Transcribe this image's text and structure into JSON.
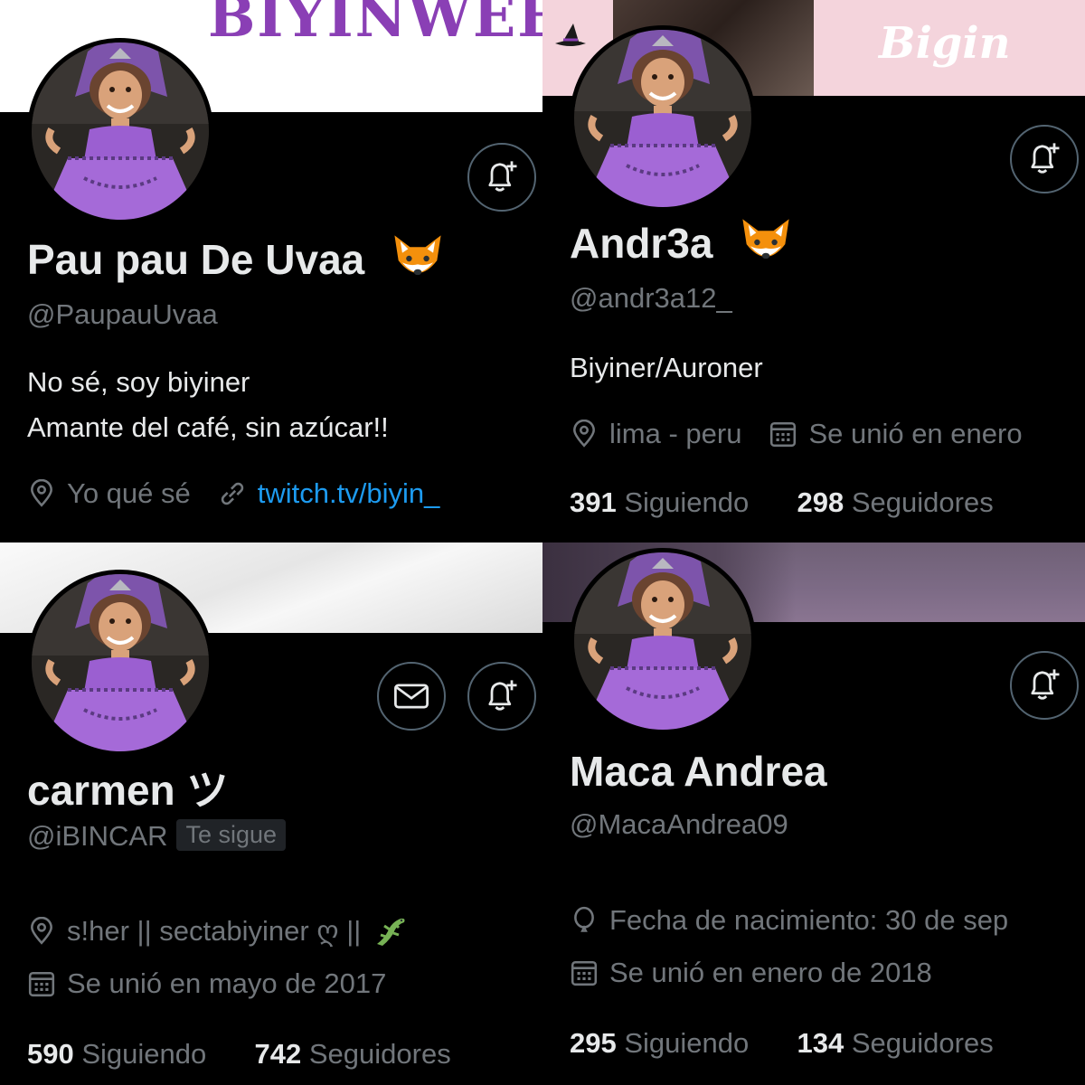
{
  "profiles": [
    {
      "banner_text": "BIYINWEEN",
      "name": "Pau pau De Uvaa",
      "name_emoji": "fox-face-icon",
      "handle": "@PaupauUvaa",
      "bio_lines": [
        "No sé, soy biyiner",
        "Amante del café, sin azúcar!!"
      ],
      "location": "Yo qué sé",
      "link": "twitch.tv/biyin_"
    },
    {
      "banner_text": "Bigin",
      "name": "Andr3a",
      "name_emoji": "fox-face-icon",
      "handle": "@andr3a12_",
      "bio_lines": [
        "Biyiner/Auroner"
      ],
      "location": "lima - peru",
      "joined": "Se unió en enero",
      "following_count": "391",
      "following_label": "Siguiendo",
      "followers_count": "298",
      "followers_label": "Seguidores"
    },
    {
      "name": "carmen ツ",
      "handle": "@iBINCAR",
      "follows_you_badge": "Te sigue",
      "location": "s!her || sectabiyiner ღ ||",
      "location_emoji": "lizard-icon",
      "joined": "Se unió en mayo de 2017",
      "following_count": "590",
      "following_label": "Siguiendo",
      "followers_count": "742",
      "followers_label": "Seguidores"
    },
    {
      "name": "Maca Andrea",
      "handle": "@MacaAndrea09",
      "birthday": "Fecha de nacimiento: 30 de sep",
      "joined": "Se unió en enero de 2018",
      "following_count": "295",
      "following_label": "Siguiendo",
      "followers_count": "134",
      "followers_label": "Seguidores"
    }
  ],
  "colors": {
    "background": "#000000",
    "primary_text": "#e7e9ea",
    "secondary_text": "#71767b",
    "link": "#1d9bf0",
    "button_border": "#536471",
    "dress_purple": "#9b5fd1"
  }
}
